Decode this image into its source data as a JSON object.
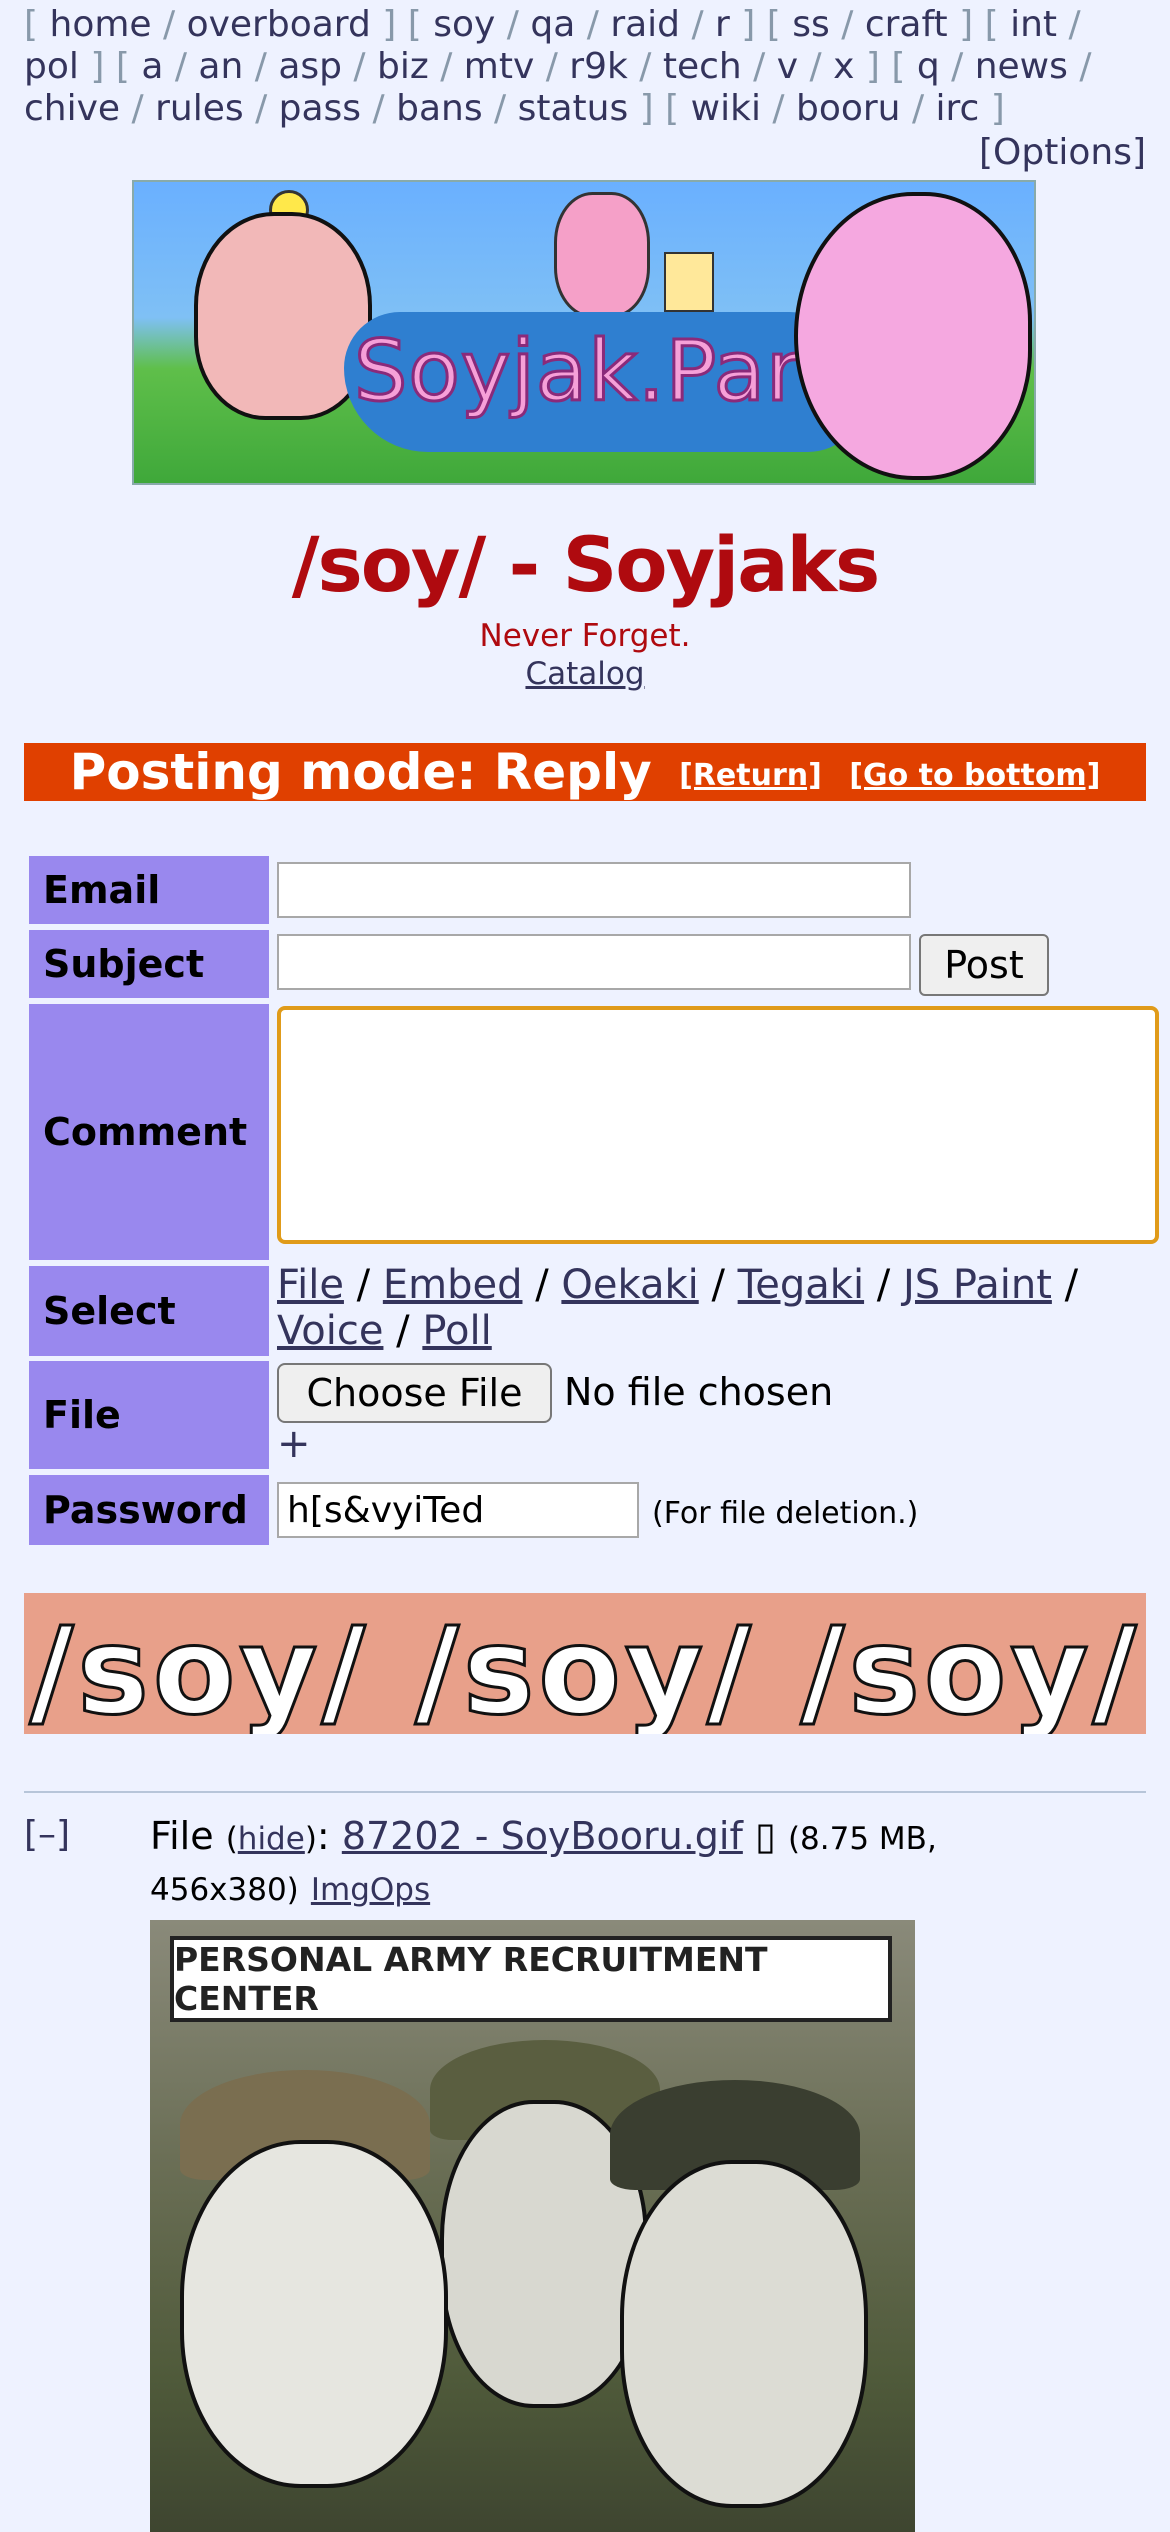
{
  "nav": {
    "groups": [
      [
        "home",
        "overboard"
      ],
      [
        "soy",
        "qa",
        "raid",
        "r"
      ],
      [
        "ss",
        "craft"
      ],
      [
        "int",
        "pol"
      ],
      [
        "a",
        "an",
        "asp",
        "biz",
        "mtv",
        "r9k",
        "tech",
        "v",
        "x"
      ],
      [
        "q",
        "news",
        "chive",
        "rules",
        "pass",
        "bans",
        "status"
      ],
      [
        "wiki",
        "booru",
        "irc"
      ]
    ],
    "options_label": "[Options]"
  },
  "banner": {
    "logo_text": "Soyjak.Party"
  },
  "board": {
    "title": "/soy/ - Soyjaks",
    "subtitle": "Never Forget.",
    "catalog_link": "Catalog"
  },
  "mode_bar": {
    "text": "Posting mode: Reply",
    "return_link": "[Return]",
    "bottom_link": "[Go to bottom]"
  },
  "form": {
    "email_label": "Email",
    "subject_label": "Subject",
    "post_button": "Post",
    "comment_label": "Comment",
    "select_label": "Select",
    "select_options": [
      "File",
      "Embed",
      "Oekaki",
      "Tegaki",
      "JS Paint",
      "Voice",
      "Poll"
    ],
    "file_label": "File",
    "choose_file_button": "Choose File",
    "no_file_text": "No file chosen",
    "add_file": "+",
    "password_label": "Password",
    "password_value": "h[s&vyiTed",
    "password_note": "(For file deletion.)"
  },
  "banner2": {
    "text": "/soy/ /soy/ /soy/"
  },
  "post": {
    "collapse": "[–]",
    "file_prefix": "File",
    "hide_link": "hide",
    "filename": "87202 - SoyBooru.gif",
    "download_glyph": "▯",
    "file_meta": "(8.75 MB, 456x380)",
    "imgops": "ImgOps",
    "image_sign": "PERSONAL ARMY RECRUITMENT CENTER"
  }
}
